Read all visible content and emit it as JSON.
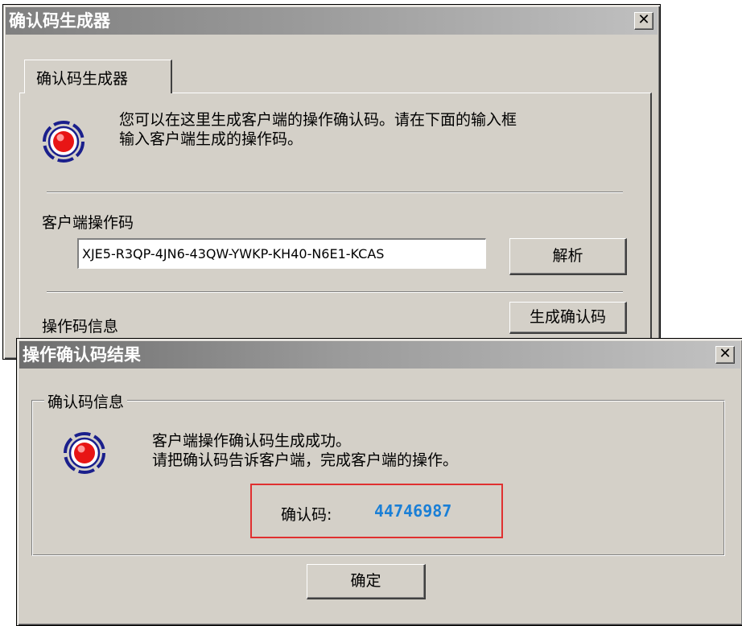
{
  "generator_window": {
    "title": "确认码生成器",
    "close_glyph": "✕",
    "tab_label": "确认码生成器",
    "description_line1": "您可以在这里生成客户端的操作确认码。请在下面的输入框",
    "description_line2": "输入客户端生成的操作码。",
    "client_code_label": "客户端操作码",
    "client_code_value": "XJE5-R3QP-4JN6-43QW-YWKP-KH40-N6E1-KCAS",
    "parse_button": "解析",
    "op_info_label": "操作码信息",
    "generate_button": "生成确认码"
  },
  "result_window": {
    "title": "操作确认码结果",
    "close_glyph": "✕",
    "group_label": "确认码信息",
    "message_line1": "客户端操作确认码生成成功。",
    "message_line2": "请把确认码告诉客户端，完成客户端的操作。",
    "code_label": "确认码:",
    "code_value": "44746987",
    "ok_button": "确定"
  },
  "colors": {
    "code_value": "#1a7fd6",
    "highlight_box": "#e03030"
  }
}
